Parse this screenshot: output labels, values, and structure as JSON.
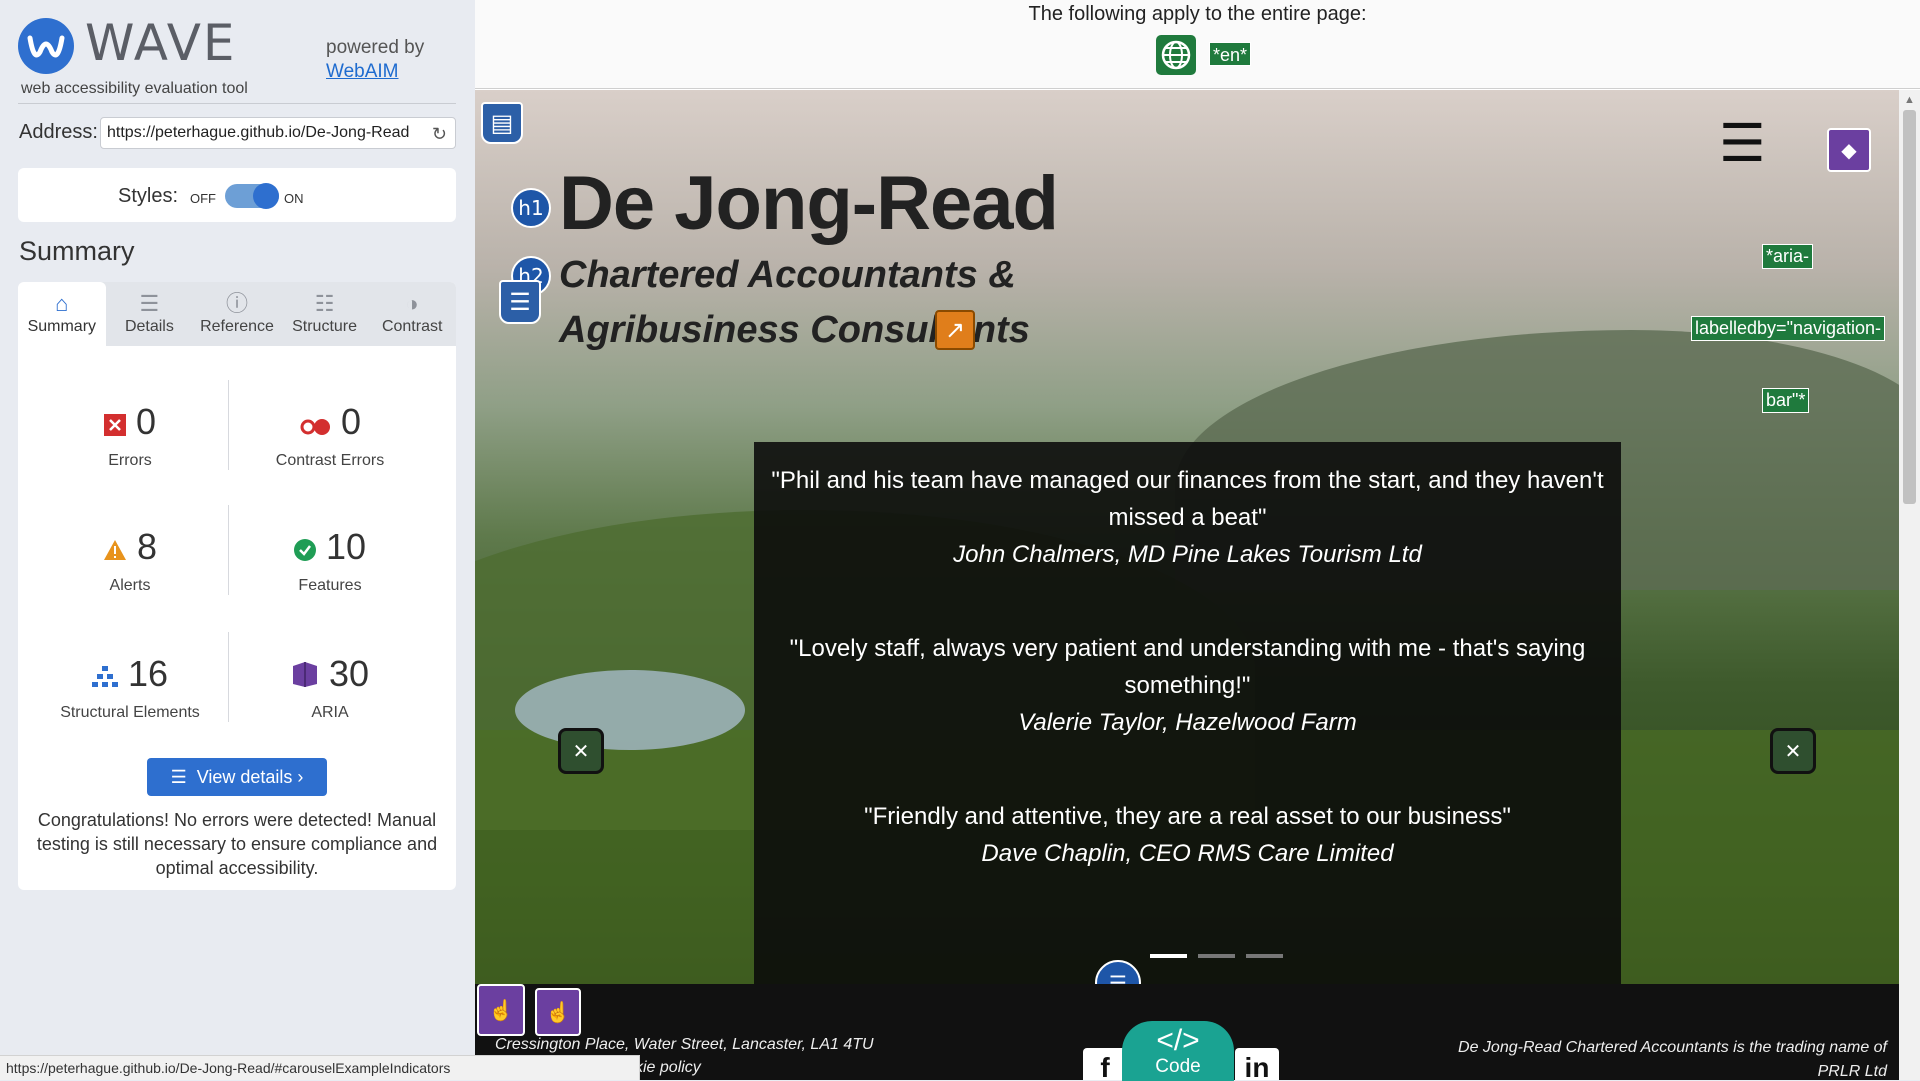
{
  "sidebar": {
    "logo_text": "WAVE",
    "logo_sub": "web accessibility evaluation tool",
    "powered_by": "powered by",
    "powered_link": "WebAIM",
    "address_label": "Address:",
    "address_value": "https://peterhague.github.io/De-Jong-Read",
    "styles_label": "Styles:",
    "styles_off": "OFF",
    "styles_on": "ON",
    "summary_title": "Summary",
    "tabs": [
      {
        "label": "Summary",
        "icon": "home-icon"
      },
      {
        "label": "Details",
        "icon": "list-icon"
      },
      {
        "label": "Reference",
        "icon": "info-icon"
      },
      {
        "label": "Structure",
        "icon": "structure-icon"
      },
      {
        "label": "Contrast",
        "icon": "contrast-icon"
      }
    ],
    "stats": [
      {
        "value": "0",
        "label": "Errors",
        "icon": "error-icon",
        "color": "#d32f2f"
      },
      {
        "value": "0",
        "label": "Contrast Errors",
        "icon": "contrast-error-icon",
        "color": "#d32f2f"
      },
      {
        "value": "8",
        "label": "Alerts",
        "icon": "alert-icon",
        "color": "#e8931c"
      },
      {
        "value": "10",
        "label": "Features",
        "icon": "feature-icon",
        "color": "#1f9d55"
      },
      {
        "value": "16",
        "label": "Structural Elements",
        "icon": "structure-icon",
        "color": "#2e6fcf"
      },
      {
        "value": "30",
        "label": "ARIA",
        "icon": "aria-icon",
        "color": "#6b3fa0"
      }
    ],
    "view_details": "View details ›",
    "congrats": "Congratulations! No errors were detected! Manual testing is still necessary to ensure compliance and optimal accessibility.",
    "status_url": "https://peterhague.github.io/De-Jong-Read/#carouselExampleIndicators"
  },
  "main": {
    "page_note": "The following apply to the entire page:",
    "lang_badge": "*en*",
    "site": {
      "h1": "De Jong-Read",
      "h2": "Chartered Accountants & Agribusiness Consultants",
      "aria_labels": [
        "*aria-",
        "labelledby=\"navigation-",
        "bar\"*"
      ],
      "quotes": [
        {
          "text": "\"Phil and his team have managed our finances from the start, and they haven't missed a beat\"",
          "who": "John Chalmers, MD Pine Lakes Tourism Ltd"
        },
        {
          "text": "\"Lovely staff, always very patient and understanding with me - that's saying something!\"",
          "who": "Valerie Taylor, Hazelwood Farm"
        },
        {
          "text": "\"Friendly and attentive, they are a real asset to our business\"",
          "who": "Dave Chaplin, CEO RMS Care Limited"
        }
      ],
      "carousel_active": 0,
      "footer_address": "Cressington Place, Water Street, Lancaster, LA1 4TU",
      "footer_cookie": "kie policy",
      "footer_legal": "De Jong-Read Chartered Accountants is the trading name of PRLR Ltd",
      "code_symbol": "</>",
      "code_label": "Code"
    }
  }
}
